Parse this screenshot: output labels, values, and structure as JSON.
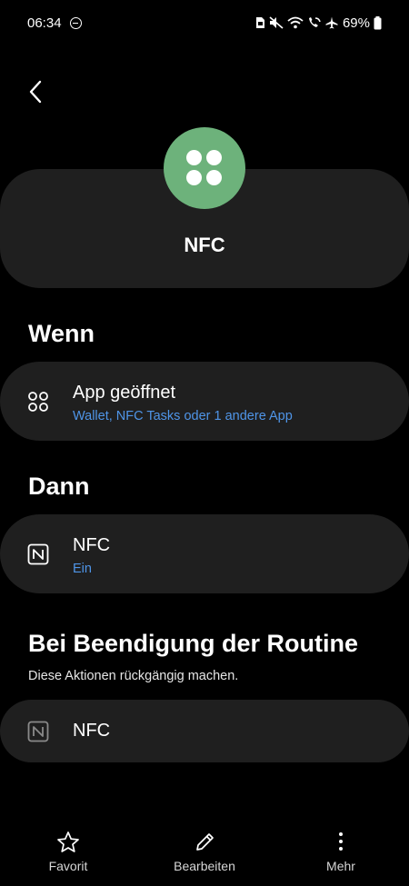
{
  "status_bar": {
    "time": "06:34",
    "battery": "69%",
    "icons": [
      "dnd-icon",
      "sim-icon",
      "mute-icon",
      "wifi-icon",
      "wifi-calling-icon",
      "airplane-icon",
      "battery-icon"
    ]
  },
  "routine": {
    "title": "NFC",
    "icon_color": "#6db27b"
  },
  "when": {
    "heading": "Wenn",
    "condition": {
      "title": "App geöffnet",
      "detail": "Wallet, NFC Tasks oder 1 andere App",
      "icon": "apps-icon"
    }
  },
  "then": {
    "heading": "Dann",
    "action": {
      "title": "NFC",
      "detail": "Ein",
      "icon": "nfc-icon"
    }
  },
  "end": {
    "heading": "Bei Beendigung der Routine",
    "subheading": "Diese Aktionen rückgängig machen.",
    "action": {
      "title": "NFC",
      "icon": "nfc-icon"
    }
  },
  "bottom_nav": {
    "favorite": "Favorit",
    "edit": "Bearbeiten",
    "more": "Mehr"
  },
  "colors": {
    "background": "#000000",
    "card": "#1f1f1f",
    "accent_text": "#4f95e8"
  }
}
